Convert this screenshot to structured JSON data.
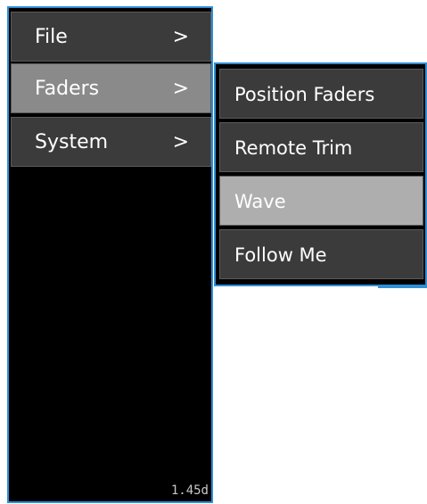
{
  "main_menu": {
    "items": [
      {
        "label": "File",
        "arrow": ">"
      },
      {
        "label": "Faders",
        "arrow": ">"
      },
      {
        "label": "System",
        "arrow": ">"
      }
    ],
    "active_item": "Faders",
    "version": "1.45d"
  },
  "submenu": {
    "items": [
      {
        "label": "Position Faders"
      },
      {
        "label": "Remote Trim"
      },
      {
        "label": "Wave"
      },
      {
        "label": "Follow Me"
      }
    ],
    "highlighted_item": "Wave"
  },
  "colors": {
    "border": "#2f8fd6",
    "background": "#000000",
    "item": "#3b3b3b",
    "item_active": "#8a8a8a",
    "item_highlight": "#aeaeae",
    "text": "#ffffff"
  }
}
